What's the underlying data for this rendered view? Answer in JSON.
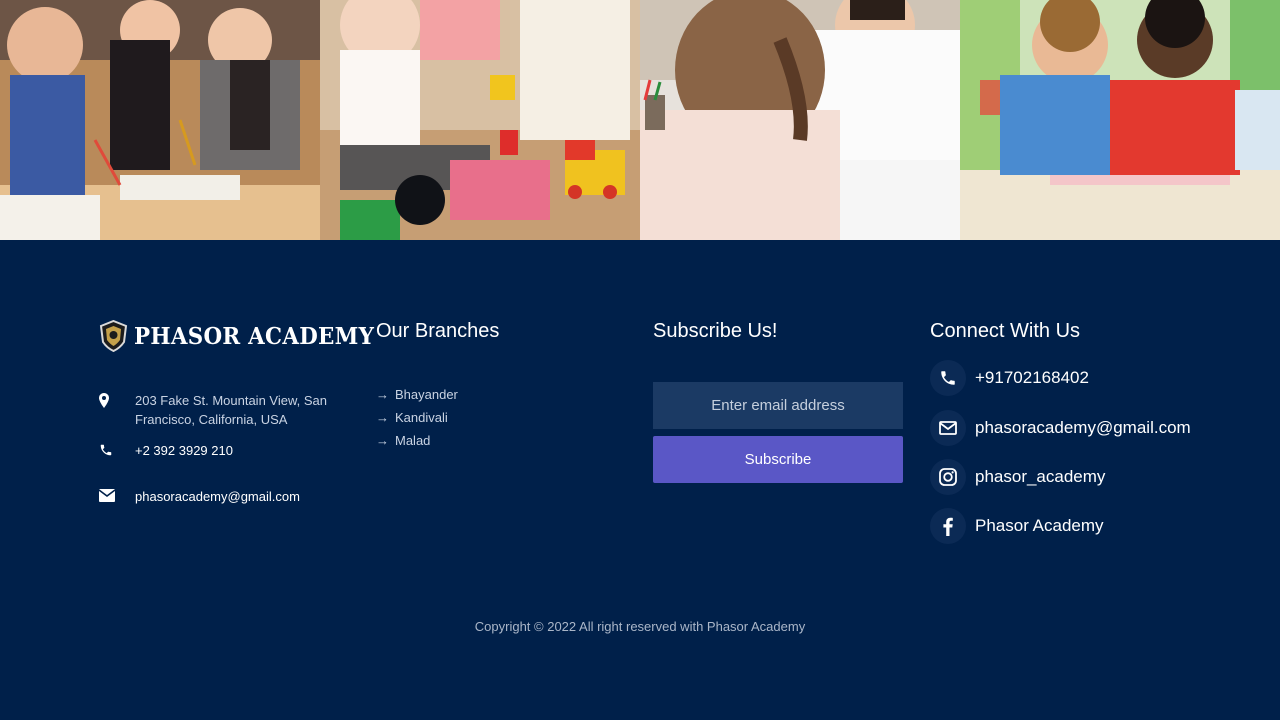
{
  "gallery": {
    "images": [
      {
        "alt": "children-drawing-with-teacher"
      },
      {
        "alt": "toddler-playing-with-blocks"
      },
      {
        "alt": "teacher-with-student"
      },
      {
        "alt": "boys-reading-book"
      }
    ]
  },
  "footer": {
    "logo_text": "PHASOR ACADEMY",
    "address": "203 Fake St. Mountain View, San Francisco, California, USA",
    "phone": "+2 392 3929 210",
    "email": "phasoracademy@gmail.com",
    "branches_title": "Our Branches",
    "branches": [
      "Bhayander",
      "Kandivali",
      "Malad"
    ],
    "subscribe_title": "Subscribe Us!",
    "email_placeholder": "Enter email address",
    "subscribe_button": "Subscribe",
    "connect_title": "Connect With Us",
    "social": [
      {
        "icon": "phone-icon",
        "label": "+91702168402"
      },
      {
        "icon": "mail-icon",
        "label": "phasoracademy@gmail.com"
      },
      {
        "icon": "instagram-icon",
        "label": "phasor_academy"
      },
      {
        "icon": "facebook-icon",
        "label": "Phasor Academy"
      }
    ],
    "copyright": "Copyright © 2022 All right reserved with Phasor Academy"
  },
  "colors": {
    "footer_bg": "#00204a",
    "accent_button": "#5a57c6",
    "input_bg": "#1b3a64"
  }
}
